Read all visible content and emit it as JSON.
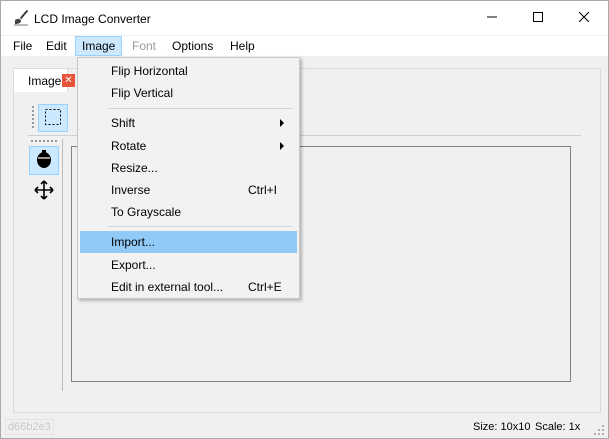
{
  "window": {
    "title": "LCD Image Converter",
    "icon": "brush-icon"
  },
  "menubar": {
    "items": [
      {
        "label": "File"
      },
      {
        "label": "Edit"
      },
      {
        "label": "Image",
        "state": "active"
      },
      {
        "label": "Font",
        "state": "disabled"
      },
      {
        "label": "Options"
      },
      {
        "label": "Help"
      }
    ]
  },
  "tabs": [
    {
      "label": "Image",
      "close_icon": "close-icon"
    }
  ],
  "tools": {
    "select": "selection-rectangle-icon",
    "fill": "fill-tool-icon",
    "move": "move-icon"
  },
  "image_menu": {
    "items": [
      {
        "label": "Flip Horizontal"
      },
      {
        "label": "Flip Vertical"
      },
      {
        "label": "Shift",
        "submenu": true
      },
      {
        "label": "Rotate",
        "submenu": true
      },
      {
        "label": "Resize..."
      },
      {
        "label": "Inverse",
        "shortcut": "Ctrl+I"
      },
      {
        "label": "To Grayscale"
      },
      {
        "label": "Import...",
        "highlighted": true
      },
      {
        "label": "Export..."
      },
      {
        "label": "Edit in external tool...",
        "shortcut": "Ctrl+E"
      }
    ]
  },
  "statusbar": {
    "id": "d66b2e3",
    "size": "Size: 10x10",
    "scale": "Scale: 1x"
  },
  "colors": {
    "accent": "#cce8ff",
    "menu_highlight": "#91c9f7",
    "tab_close": "#e8533b"
  }
}
